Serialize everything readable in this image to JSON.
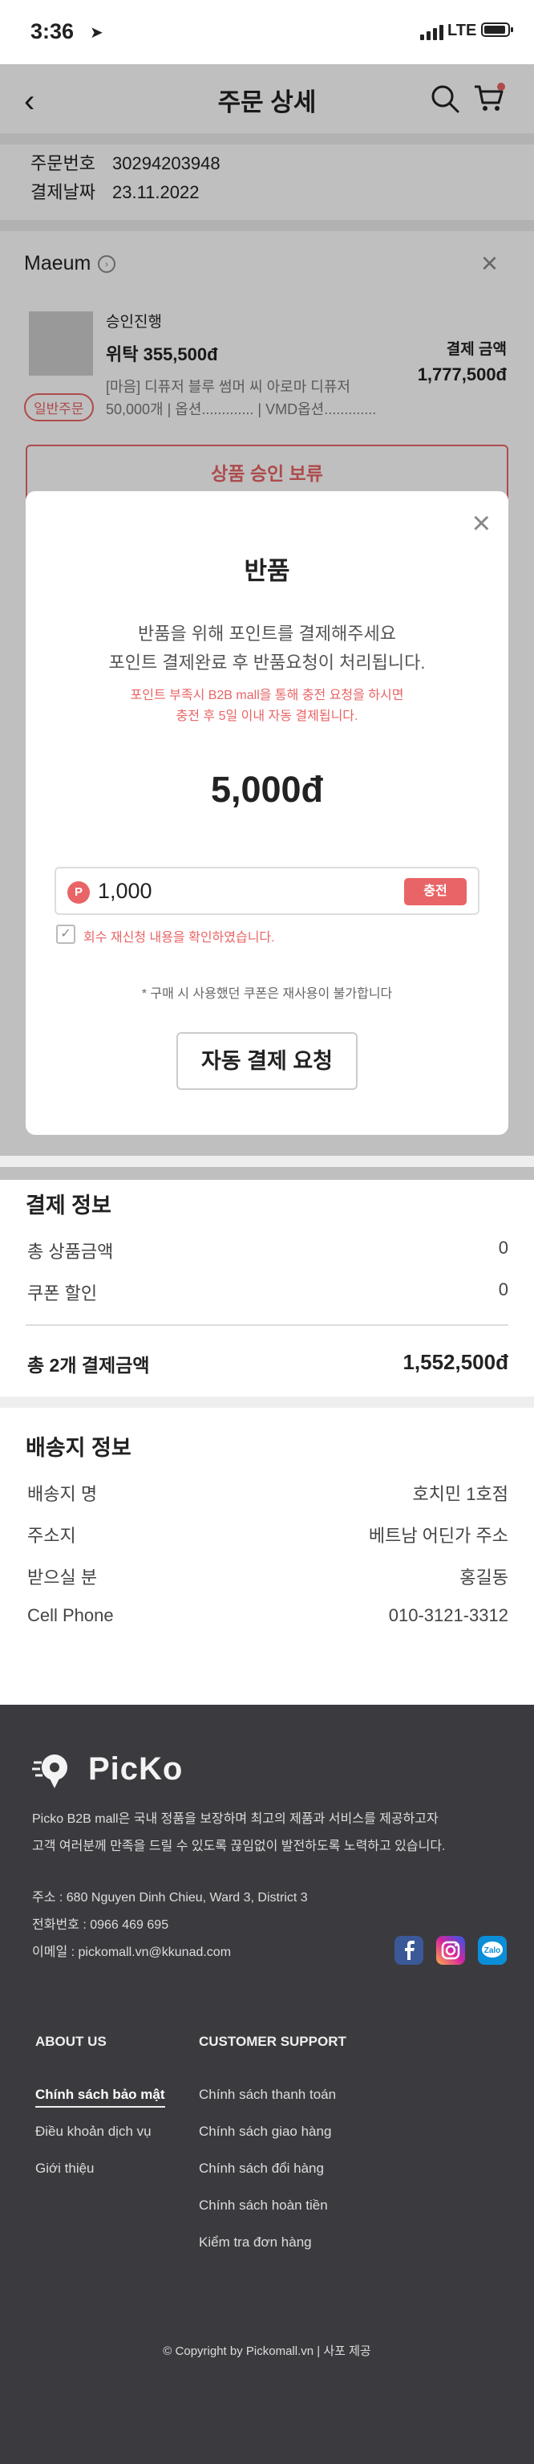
{
  "status_bar": {
    "time": "3:36",
    "network": "LTE"
  },
  "header": {
    "title": "주문 상세"
  },
  "order": {
    "number_label": "주문번호",
    "number": "30294203948",
    "date_label": "결제날짜",
    "date": "23.11.2022"
  },
  "store": {
    "name": "Maeum",
    "product": {
      "status": "승인진행",
      "price": "위탁  355,500đ",
      "desc_line1": "[마음] 디퓨저 블루 썸머 씨 아로마 디퓨저",
      "desc_line2": "50,000개 | 옵션............. | VMD옵션.............",
      "badge": "일반주문",
      "amount_label": "결제 금액",
      "amount": "1,777,500đ"
    },
    "hold_button": "상품 승인 보류"
  },
  "modal": {
    "title": "반품",
    "line1": "반품을 위해 포인트를 결제해주세요",
    "line2": "포인트 결제완료 후 반품요청이 처리됩니다.",
    "warn1": "포인트 부족시 B2B mall을 통해 충전 요청을 하시면",
    "warn2": "충전 후 5일 이내 자동 결제됩니다.",
    "amount": "5,000đ",
    "point_badge": "P",
    "point_value": "1,000",
    "charge_button": "충전",
    "checkbox_label": "회수 재신청 내용을 확인하였습니다.",
    "coupon_note": "* 구매 시 사용했던 쿠폰은 재사용이 불가합니다",
    "auto_pay_button": "자동 결제 요청"
  },
  "payment": {
    "title": "결제 정보",
    "rows": [
      {
        "label": "총 상품금액",
        "value": "0"
      },
      {
        "label": "쿠폰 할인",
        "value": "0"
      }
    ],
    "total_label": "총 2개 결제금액",
    "total_value": "1,552,500đ"
  },
  "shipping": {
    "title": "배송지 정보",
    "rows": [
      {
        "label": "배송지 명",
        "value": "호치민 1호점"
      },
      {
        "label": "주소지",
        "value": "베트남 어딘가 주소"
      },
      {
        "label": "받으실 분",
        "value": "홍길동"
      },
      {
        "label": "Cell Phone",
        "value": "010-3121-3312"
      }
    ]
  },
  "footer": {
    "logo_text": "PicKo",
    "desc1": "Picko B2B mall은 국내 정품을 보장하며 최고의 제품과 서비스를 제공하고자",
    "desc2": "고객 여러분께 만족을 드릴 수 있도록 끊임없이 발전하도록 노력하고 있습니다.",
    "address": "주소 : 680 Nguyen Dinh Chieu, Ward 3, District 3",
    "phone": "전화번호 : 0966 469 695",
    "email": "이메일 : pickomall.vn@kkunad.com",
    "socials": [
      {
        "icon": "facebook-icon",
        "color": "#3b5998"
      },
      {
        "icon": "instagram-icon",
        "color": "#d6249f"
      },
      {
        "icon": "zalo-icon",
        "color": "#0b8ed8",
        "text": "Zalo"
      }
    ],
    "about_title": "ABOUT US",
    "about_links": [
      "Chính sách bảo mật",
      "Điều khoản dịch vụ",
      "Giới thiệu"
    ],
    "support_title": "CUSTOMER SUPPORT",
    "support_links": [
      "Chính sách thanh toán",
      "Chính sách giao hàng",
      "Chính sách đổi hàng",
      "Chính sách hoàn tiền",
      "Kiểm tra đơn hàng"
    ],
    "copyright": "© Copyright by Pickomall.vn | 사포 제공"
  },
  "colors": {
    "accent": "#e96466",
    "footer_bg": "#3b3b3f"
  }
}
